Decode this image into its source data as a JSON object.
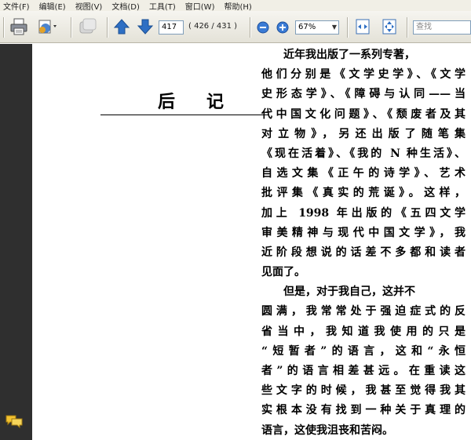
{
  "menu": {
    "items": [
      "文件(F)",
      "编辑(E)",
      "视图(V)",
      "文档(D)",
      "工具(T)",
      "窗口(W)",
      "帮助(H)"
    ]
  },
  "toolbar": {
    "page_number": "417",
    "page_count": "( 426 / 431 )",
    "zoom": "67%",
    "search_placeholder": "查找"
  },
  "icons": {
    "print": "printer-icon",
    "collaborate": "collaborate-icon",
    "hand": "hand-icon",
    "prev": "up-arrow-icon",
    "next": "down-arrow-icon",
    "zoom_out": "zoom-out-icon",
    "zoom_in": "zoom-in-icon",
    "fit_width": "fit-width-icon",
    "fit_page": "fit-page-icon",
    "comments": "comments-icon"
  },
  "colors": {
    "nav_pane": "#2f2f2f",
    "arrow_blue": "#2e6fc4"
  },
  "document": {
    "title": "后记",
    "paragraphs": [
      {
        "lines": [
          "近年我出版了一系列专著，",
          "他们分别是《文学史学》、《文学",
          "史形态学》、《障碍与认同——当",
          "代中国文化问题》、《颓废者及其",
          "对立物》，另还出版了随笔集",
          "《现在活着》、《我的 N 种生活》、",
          "自选文集《正午的诗学》、艺术",
          "批评集《真实的荒诞》。这样，",
          "加上 1998 年出版的《五四文学",
          "审美精神与现代中国文学》，我",
          "近阶段想说的话差不多都和读者",
          "见面了。"
        ]
      },
      {
        "lines": [
          "但是，对于我自己，这并不",
          "圆满，我常常处于强迫症式的反",
          "省当中，我知道我使用的只是",
          "“短暂者”的语言，这和“永恒",
          "者”的语言相差甚远。在重读这",
          "些文字的时候，我甚至觉得我其",
          "实根本没有找到一种关于真理的",
          "语言，这使我沮丧和苦闷。"
        ]
      }
    ]
  }
}
